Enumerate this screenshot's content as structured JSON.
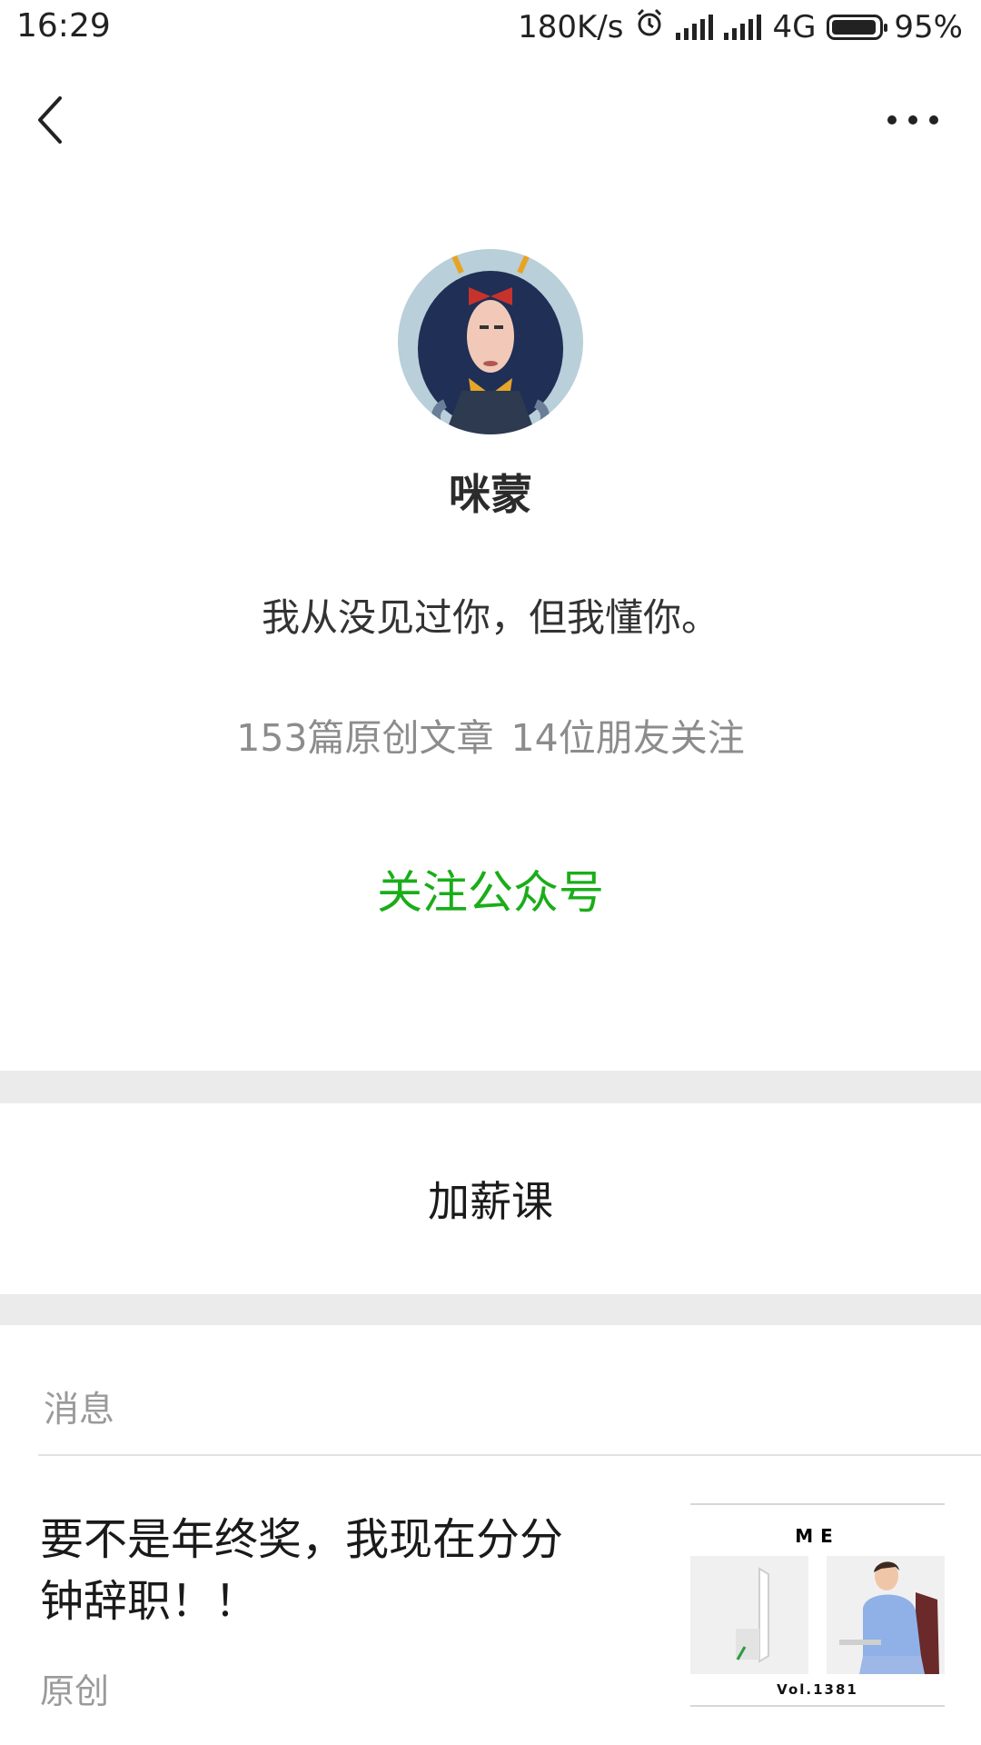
{
  "status_bar": {
    "time": "16:29",
    "speed": "180K/s",
    "network": "4G",
    "battery": "95%",
    "icons": [
      "alarm-icon",
      "signal-icon",
      "signal-icon",
      "battery-icon"
    ]
  },
  "nav": {
    "back_icon": "chevron-left-icon",
    "more_icon": "more-dots-icon"
  },
  "profile": {
    "name": "咪蒙",
    "bio": "我从没见过你，但我懂你。",
    "stats": "153篇原创文章  14位朋友关注",
    "follow_label": "关注公众号"
  },
  "menu": {
    "item_label": "加薪课"
  },
  "messages": {
    "section_label": "消息",
    "articles": [
      {
        "title": "要不是年终奖，我现在分分钟辞职！！",
        "tag": "原创",
        "thumb_top": "ME",
        "thumb_bottom": "Vol.1381"
      }
    ]
  },
  "colors": {
    "accent_green": "#1aad19",
    "divider_gray": "#ebebeb",
    "secondary_text": "#8c8c8c"
  }
}
